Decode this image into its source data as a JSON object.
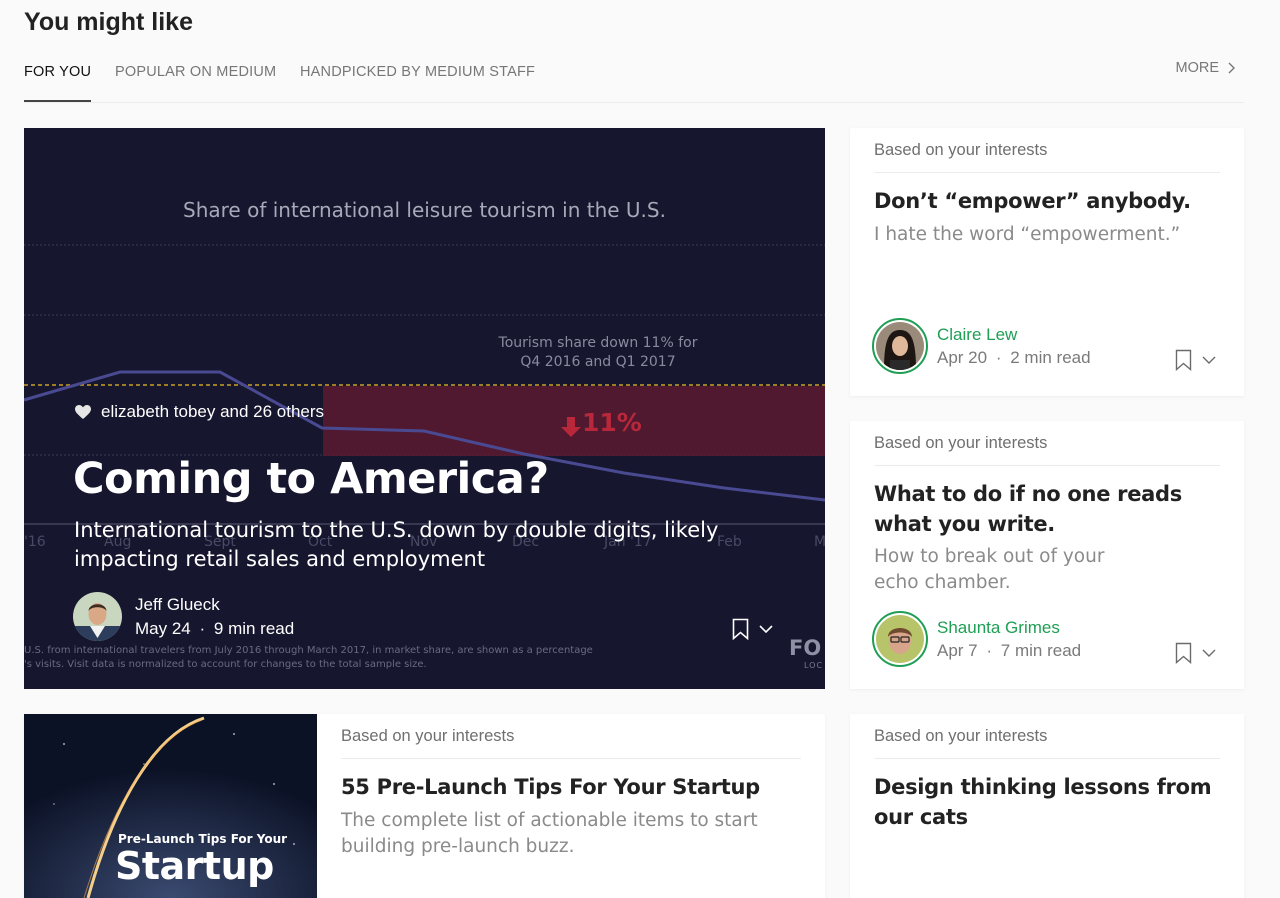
{
  "section": {
    "title": "You might like"
  },
  "tabs": [
    {
      "label": "FOR YOU"
    },
    {
      "label": "POPULAR ON MEDIUM"
    },
    {
      "label": "HANDPICKED BY MEDIUM STAFF"
    }
  ],
  "more_label": "MORE",
  "featured": {
    "recommended_by": "elizabeth tobey and 26 others",
    "title": "Coming to America?",
    "subtitle": "International tourism to the U.S. down by double digits, likely impacting retail sales and employment",
    "author": "Jeff Glueck",
    "date": "May 24",
    "read_time": "9 min read",
    "image": {
      "chart_title": "Share of international leisure tourism in the U.S.",
      "annotation_line1": "Tourism share down 11% for",
      "annotation_line2": "Q4 2016 and Q1 2017",
      "percent": "11%",
      "months": [
        "'16",
        "Aug",
        "Sept",
        "Oct",
        "Nov",
        "Dec",
        "Jan '17",
        "Feb",
        "M"
      ],
      "source_line1": "U.S. from international travelers from July 2016 through March 2017, in market share, are shown as a percentage",
      "source_line2": "'s visits. Visit data is normalized to account for changes to the total sample size.",
      "logo": "FO",
      "logo_sub": "LOC"
    }
  },
  "cards": [
    {
      "label": "Based on your interests",
      "title": "Don’t “empower” anybody.",
      "subtitle": "I hate the word “empowerment.”",
      "author": "Claire Lew",
      "date": "Apr 20",
      "read_time": "2 min read"
    },
    {
      "label": "Based on your interests",
      "title": "What to do if no one reads what you write.",
      "subtitle": "How to break out of your echo chamber.",
      "author": "Shaunta Grimes",
      "date": "Apr 7",
      "read_time": "7 min read"
    },
    {
      "label": "Based on your interests",
      "title": "55 Pre-Launch Tips For Your Startup",
      "subtitle": "The complete list of actionable items to start building pre-launch buzz.",
      "image_small": "Pre-Launch Tips For Your",
      "image_big": "Startup"
    },
    {
      "label": "Based on your interests",
      "title": "Design thinking lessons from our cats"
    }
  ],
  "colors": {
    "accent_green": "#1f9e54",
    "feature_bg": "#16162e",
    "drop_red": "#b8283a"
  },
  "meta_separator": "·"
}
